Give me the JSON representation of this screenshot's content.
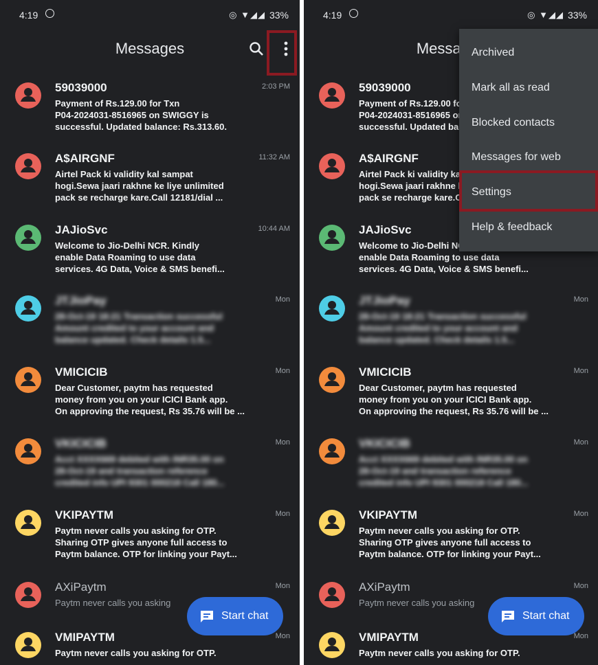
{
  "status_bar": {
    "time": "4:19",
    "battery": "33%"
  },
  "app_bar": {
    "title": "Messages"
  },
  "messages": [
    {
      "sender": "59039000",
      "time": "2:03 PM",
      "preview": "Payment of Rs.129.00 for Txn\nP04-2024031-8516965 on SWIGGY is\nsuccessful. Updated balance: Rs.313.60.",
      "color": "#e8625a",
      "read": false,
      "blurred": false
    },
    {
      "sender": "A$AIRGNF",
      "time": "11:32 AM",
      "preview": "Airtel Pack ki validity kal sampat\nhogi.Sewa jaari rakhne ke liye unlimited\npack se recharge kare.Call 12181/dial ...",
      "color": "#e8625a",
      "read": false,
      "blurred": false
    },
    {
      "sender": "JAJioSvc",
      "time": "10:44 AM",
      "preview": "Welcome to Jio-Delhi NCR. Kindly\nenable Data Roaming to use data\nservices. 4G Data, Voice & SMS benefi...",
      "color": "#5bb974",
      "read": false,
      "blurred": false
    },
    {
      "sender": "JTJioPay",
      "time": "Mon",
      "preview": "28-Oct-19 18:21 Transaction successful\nAmount credited to your account and\nbalance updated. Check details 1.5...",
      "color": "#4ecde6",
      "read": false,
      "blurred": true
    },
    {
      "sender": "VMICICIB",
      "time": "Mon",
      "preview": "Dear Customer, paytm has requested\nmoney from you on your ICICI Bank app.\nOn approving the request, Rs 35.76 will be ...",
      "color": "#f28b3c",
      "read": false,
      "blurred": false
    },
    {
      "sender": "VKICICIB",
      "time": "Mon",
      "preview": "Acct XXXX669 debited with INR35.00 on\n28-Oct-19 and transaction reference\ncredited info UPI 9301 000218 Call 180...",
      "color": "#f28b3c",
      "read": false,
      "blurred": true
    },
    {
      "sender": "VKIPAYTM",
      "time": "Mon",
      "preview": "Paytm never calls you asking for OTP.\nSharing OTP gives anyone full access to\nPaytm balance. OTP for linking your Payt...",
      "color": "#fdd663",
      "read": false,
      "blurred": false
    },
    {
      "sender": "AXiPaytm",
      "time": "Mon",
      "preview": "Paytm never calls you asking",
      "color": "#e8625a",
      "read": true,
      "blurred": false
    },
    {
      "sender": "VMIPAYTM",
      "time": "Mon",
      "preview": "Paytm never calls you asking for OTP.",
      "color": "#fdd663",
      "read": false,
      "blurred": false
    }
  ],
  "fab": {
    "label": "Start chat"
  },
  "overflow_menu": {
    "items": [
      "Archived",
      "Mark all as read",
      "Blocked contacts",
      "Messages for web",
      "Settings",
      "Help & feedback"
    ]
  },
  "icons": {
    "search": "search-icon",
    "more": "more-vert-icon",
    "avatar": "person-icon",
    "fab": "chat-icon"
  },
  "colors": {
    "background": "#202124",
    "menu_bg": "#3c4043",
    "fab": "#2e6ad8",
    "highlight": "#8b1a22"
  }
}
